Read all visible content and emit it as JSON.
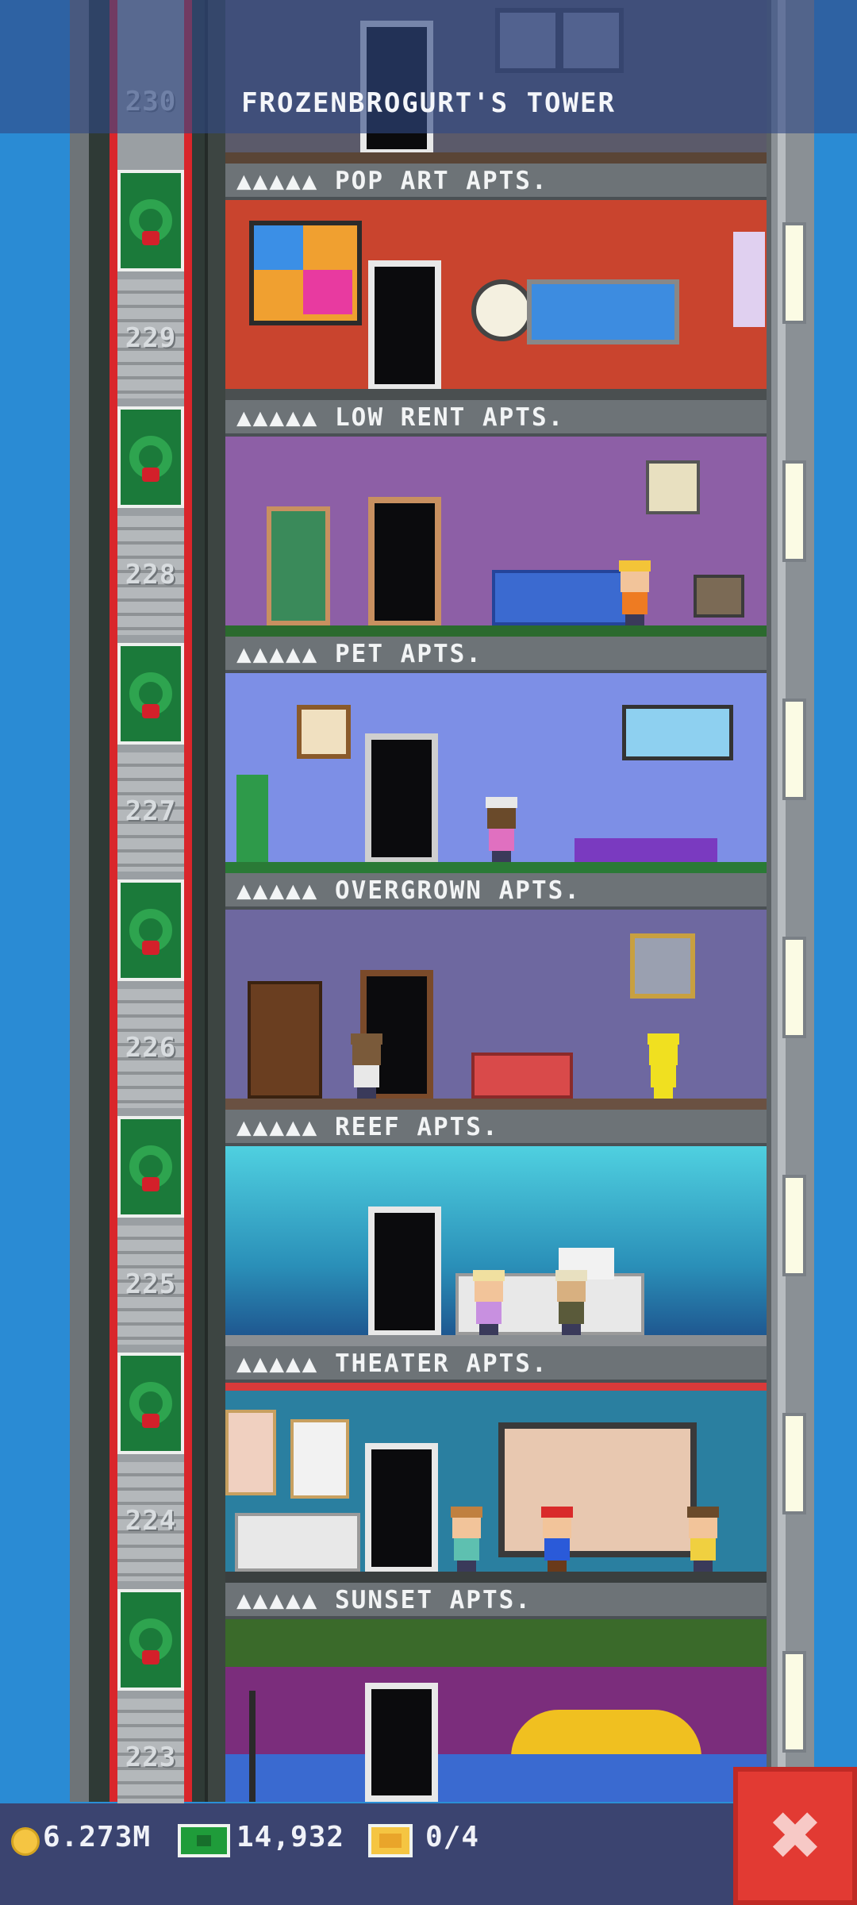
{
  "header": {
    "title": "FROZENBROGURT'S TOWER"
  },
  "floors": [
    {
      "number": "229",
      "name": "POP ART APTS.",
      "occupancy": "▲▲▲▲▲",
      "wall": "#c9442e",
      "floor": "#4a4f50"
    },
    {
      "number": "228",
      "name": "LOW RENT APTS.",
      "occupancy": "▲▲▲▲▲",
      "wall": "#8d5fa6",
      "floor": "#2b6a2e"
    },
    {
      "number": "227",
      "name": "PET APTS.",
      "occupancy": "▲▲▲▲▲",
      "wall": "#7d8fe6",
      "floor": "#2a7a36"
    },
    {
      "number": "226",
      "name": "OVERGROWN APTS.",
      "occupancy": "▲▲▲▲▲",
      "wall": "#6e68a0",
      "floor": "#6a5142"
    },
    {
      "number": "225",
      "name": "REEF APTS.",
      "occupancy": "▲▲▲▲▲",
      "wall": "#3fb6c8",
      "floor": "#8a8e92"
    },
    {
      "number": "224",
      "name": "THEATER APTS.",
      "occupancy": "▲▲▲▲▲",
      "wall": "#2a7fa0",
      "floor": "#3a3f3f"
    },
    {
      "number": "223",
      "name": "SUNSET APTS.",
      "occupancy": "▲▲▲▲▲",
      "wall": "#7b2d7c",
      "floor": "#2a2a3a"
    }
  ],
  "top_floor_number": "230",
  "status_bar": {
    "coins": "6.273M",
    "bux": "14,932",
    "tickets": "0/4"
  },
  "icons": {
    "coin": "coin-icon",
    "bux": "tower-bux-icon",
    "ticket": "golden-ticket-icon",
    "close": "close-icon",
    "wreath": "wreath-icon"
  },
  "colors": {
    "sky": "#2a8bd4",
    "header_bg": "#304884",
    "bottom_bar": "#3b4470",
    "close_button": "#e23a33",
    "elevator_rail": "#d9262b"
  }
}
